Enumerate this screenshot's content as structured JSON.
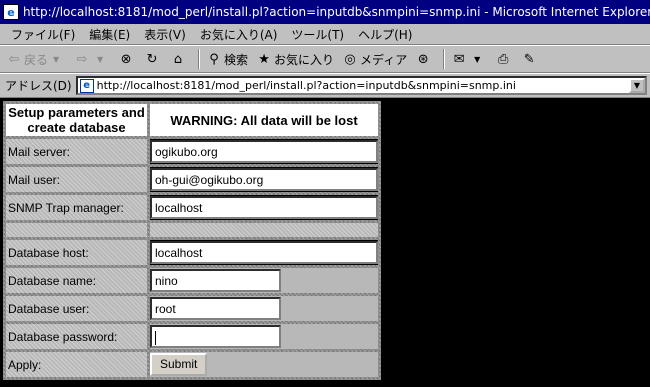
{
  "window": {
    "title": "http://localhost:8181/mod_perl/install.pl?action=inputdb&snmpini=snmp.ini - Microsoft Internet Explorer"
  },
  "menu": [
    "ファイル(F)",
    "編集(E)",
    "表示(V)",
    "お気に入り(A)",
    "ツール(T)",
    "ヘルプ(H)"
  ],
  "toolbar": {
    "back": "戻る",
    "search": "検索",
    "favorites": "お気に入り",
    "media": "メディア"
  },
  "address": {
    "label": "アドレス(D)",
    "url": "http://localhost:8181/mod_perl/install.pl?action=inputdb&snmpini=snmp.ini"
  },
  "form": {
    "header_left": "Setup parameters and create database",
    "header_right": "WARNING: All data will be lost",
    "mail_server": {
      "label": "Mail server:",
      "value": "ogikubo.org"
    },
    "mail_user": {
      "label": "Mail user:",
      "value": "oh-gui@ogikubo.org"
    },
    "snmp_trap": {
      "label": "SNMP Trap manager:",
      "value": "localhost"
    },
    "db_host": {
      "label": "Database host:",
      "value": "localhost"
    },
    "db_name": {
      "label": "Database name:",
      "value": "nino"
    },
    "db_user": {
      "label": "Database user:",
      "value": "root"
    },
    "db_password": {
      "label": "Database password:",
      "value": ""
    },
    "apply": {
      "label": "Apply:",
      "button": "Submit"
    }
  }
}
